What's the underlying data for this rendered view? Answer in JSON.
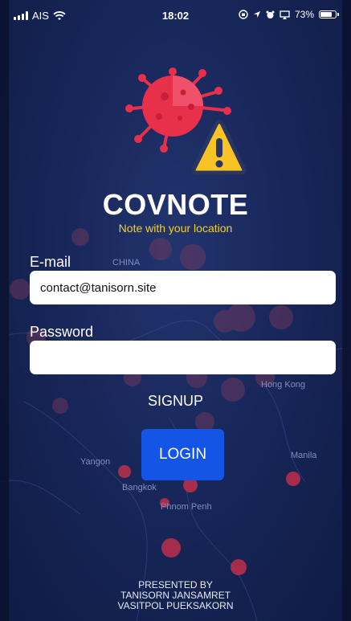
{
  "status_bar": {
    "carrier": "AIS",
    "time": "18:02",
    "battery": "73%",
    "icons": [
      "signal-icon",
      "wifi-icon",
      "orientation-lock-icon",
      "location-icon",
      "alarm-icon",
      "screen-mirroring-icon",
      "battery-icon"
    ]
  },
  "app": {
    "name": "COVNOTE",
    "tagline": "Note with your location",
    "logo_icon": "virus-warning-logo"
  },
  "background_map": {
    "labels": [
      "CHINA",
      "Hong Kong",
      "Yangon",
      "Bangkok",
      "Phnom Penh",
      "Manila"
    ]
  },
  "form": {
    "email_label": "E-mail",
    "email_value": "contact@tanisorn.site",
    "password_label": "Password",
    "password_value": "",
    "signup_label": "SIGNUP",
    "login_label": "LOGIN"
  },
  "footer": {
    "line1": "PRESENTED BY",
    "line2": "TANISORN JANSAMRET",
    "line3": "VASITPOL PUEKSAKORN"
  },
  "colors": {
    "background": "#18275a",
    "accent": "#1455e6",
    "tagline": "#f5d020",
    "virus": "#e8304a",
    "warning": "#f7c325"
  }
}
